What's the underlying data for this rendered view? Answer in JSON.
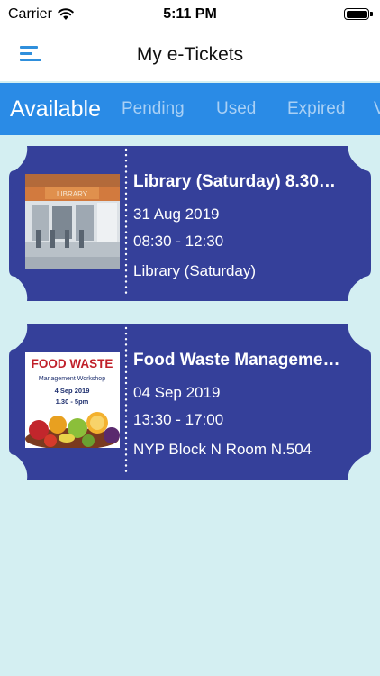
{
  "status": {
    "carrier": "Carrier",
    "time": "5:11 PM"
  },
  "nav": {
    "title": "My e-Tickets"
  },
  "tabs": [
    {
      "label": "Available",
      "active": true
    },
    {
      "label": "Pending",
      "active": false
    },
    {
      "label": "Used",
      "active": false
    },
    {
      "label": "Expired",
      "active": false
    },
    {
      "label": "V",
      "active": false
    }
  ],
  "tickets": [
    {
      "title": "Library (Saturday) 8.30…",
      "date": "31 Aug 2019",
      "time": "08:30 - 12:30",
      "location": "Library (Saturday)",
      "image": {
        "sign": "LIBRARY"
      }
    },
    {
      "title": "Food Waste Manageme…",
      "date": "04 Sep 2019",
      "time": "13:30 - 17:00",
      "location": "NYP Block N Room N.504",
      "image": {
        "heading": "FOOD WASTE",
        "subheading": "Management Workshop",
        "date": "4 Sep 2019",
        "time": "1.30 - 5pm"
      }
    }
  ],
  "colors": {
    "tab_bar": "#2a8be6",
    "ticket": "#35409a",
    "background": "#d4eff2",
    "menu_icon": "#2f8fdc"
  }
}
